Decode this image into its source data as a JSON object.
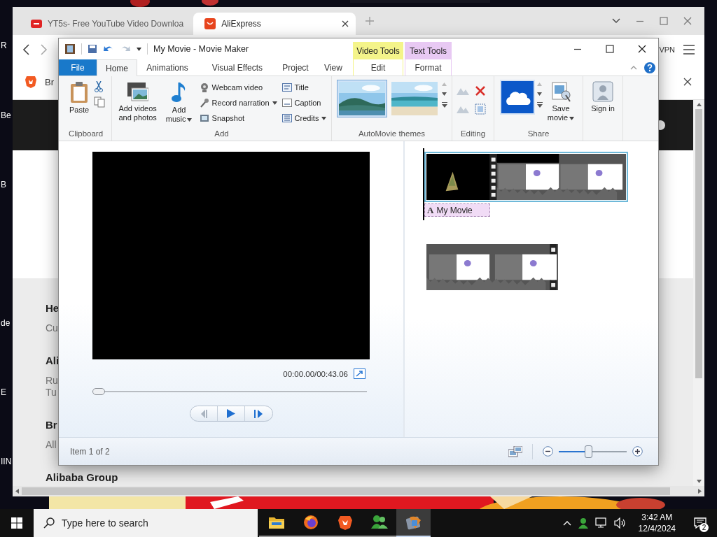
{
  "desktop": {
    "icon_labels": [
      "R",
      "Be",
      "B",
      "de",
      "E",
      "IIN"
    ]
  },
  "browser": {
    "tabs": [
      {
        "title": "YT5s- Free YouTube Video Downloa",
        "selected": false
      },
      {
        "title": "AliExpress",
        "selected": true
      }
    ],
    "toolbar": {
      "vpn": "VPN"
    },
    "info_bar": {
      "text": "Br"
    },
    "page": {
      "sections": [
        {
          "heading": "He",
          "lines": [
            "Cu"
          ]
        },
        {
          "heading": "Ali",
          "lines": [
            "Ru",
            "Tu"
          ]
        },
        {
          "heading": "Br",
          "lines": [
            "All"
          ]
        },
        {
          "heading": "Alibaba Group"
        }
      ]
    }
  },
  "movie_maker": {
    "title": "My Movie - Movie Maker",
    "tabs": [
      {
        "label": "File",
        "kind": "file",
        "selected": false
      },
      {
        "label": "Home",
        "kind": "tab",
        "selected": true
      },
      {
        "label": "Animations",
        "kind": "tab",
        "selected": false
      },
      {
        "label": "Visual Effects",
        "kind": "tab",
        "selected": false
      },
      {
        "label": "Project",
        "kind": "tab",
        "selected": false
      },
      {
        "label": "View",
        "kind": "tab",
        "selected": false
      }
    ],
    "contextual_tabs": [
      {
        "header": "Video Tools",
        "color": "#f4f48a",
        "tabs": [
          {
            "label": "Edit",
            "selected": false
          }
        ]
      },
      {
        "header": "Text Tools",
        "color": "#e8c9f3",
        "tabs": [
          {
            "label": "Format",
            "selected": false
          }
        ]
      }
    ],
    "ribbon_groups": [
      {
        "kind": "clipboard",
        "label": "Clipboard",
        "buttons": [
          {
            "label": "Paste",
            "dropdown": false
          }
        ]
      },
      {
        "kind": "add",
        "label": "Add",
        "buttons": [
          {
            "label": "Add videos and photos",
            "dropdown": false
          },
          {
            "label": "Add music",
            "dropdown": true
          }
        ],
        "small_buttons": [
          {
            "label": "Webcam video",
            "dropdown": false
          },
          {
            "label": "Record narration",
            "dropdown": true
          },
          {
            "label": "Snapshot",
            "dropdown": false
          },
          {
            "label": "Title",
            "dropdown": false
          },
          {
            "label": "Caption",
            "dropdown": false
          },
          {
            "label": "Credits",
            "dropdown": true
          }
        ]
      },
      {
        "kind": "themes",
        "label": "AutoMovie themes",
        "themes": [
          {
            "selected": true
          },
          {
            "selected": false
          }
        ]
      },
      {
        "kind": "editing",
        "label": "Editing"
      },
      {
        "kind": "share",
        "label": "Share",
        "buttons": [
          {
            "label": "Save movie",
            "dropdown": true
          }
        ]
      },
      {
        "kind": "account",
        "buttons": [
          {
            "label": "Sign in",
            "dropdown": false
          }
        ]
      }
    ],
    "preview": {
      "time": "00:00.00/00:43.06",
      "seek": {
        "level": 0
      }
    },
    "storyboard": {
      "clips": [
        {
          "selected": true,
          "caption": {
            "icon": "A",
            "text": "My Movie"
          }
        },
        {
          "selected": false
        }
      ]
    },
    "status_bar": {
      "text": "Item 1 of 2",
      "zoom": {
        "level": 0.42
      }
    }
  },
  "taskbar": {
    "search": {
      "placeholder": "Type here to search"
    },
    "apps": [
      {
        "kind": "folder",
        "selected": false
      },
      {
        "kind": "globe",
        "selected": false
      },
      {
        "kind": "lion",
        "selected": false
      },
      {
        "kind": "people",
        "selected": false
      },
      {
        "kind": "film",
        "selected": true
      }
    ],
    "clock": {
      "time": "3:42 AM",
      "date": "12/4/2024"
    },
    "notifications": "2"
  }
}
